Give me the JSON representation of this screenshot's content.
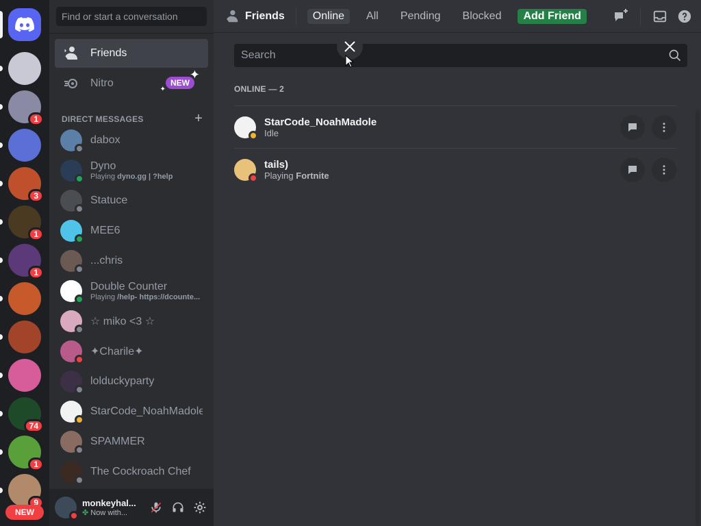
{
  "sidebar": {
    "search_placeholder": "Find or start a conversation",
    "nav": {
      "friends": "Friends",
      "nitro": "Nitro",
      "new_badge": "NEW"
    },
    "dm_header": "DIRECT MESSAGES",
    "dms": [
      {
        "name": "dabox",
        "sub": "",
        "status": "offline",
        "color": "#5b7fa6"
      },
      {
        "name": "Dyno",
        "sub_prefix": "Playing ",
        "sub_bold": "dyno.gg | ?help",
        "status": "online",
        "color": "#2a3c56"
      },
      {
        "name": "Statuce",
        "sub": "",
        "status": "offline",
        "color": "#4a4d52"
      },
      {
        "name": "MEE6",
        "sub": "",
        "status": "online",
        "color": "#4fc3e8"
      },
      {
        "name": "...chris",
        "sub": "",
        "status": "offline",
        "color": "#6b5a54"
      },
      {
        "name": "Double Counter",
        "sub_prefix": "Playing ",
        "sub_bold": "/help- https://dcounte...",
        "status": "online",
        "color": "#ffffff"
      },
      {
        "name": "☆ miko <3 ☆",
        "sub": "",
        "status": "offline",
        "color": "#d9a9c0"
      },
      {
        "name": "✦Charile✦",
        "sub": "",
        "status": "dnd",
        "color": "#b85a8a"
      },
      {
        "name": "lolduckyparty",
        "sub": "",
        "status": "offline",
        "color": "#3b3046"
      },
      {
        "name": "StarCode_NoahMadole",
        "sub": "",
        "status": "idle",
        "color": "#f2f2f2"
      },
      {
        "name": "SPAMMER",
        "sub": "",
        "status": "offline",
        "color": "#8a6b62"
      },
      {
        "name": "The Cockroach Chef",
        "sub": "",
        "status": "offline",
        "color": "#3a2a22"
      }
    ]
  },
  "rail": {
    "servers": [
      {
        "badge": "",
        "color": "#c9c9d6",
        "pill": "dot"
      },
      {
        "badge": "1",
        "color": "#8a8aa5",
        "pill": "dot"
      },
      {
        "badge": "",
        "color": "#5b6fd6",
        "pill": "dot"
      },
      {
        "badge": "3",
        "color": "#c0502c",
        "pill": "dot"
      },
      {
        "badge": "1",
        "color": "#4a3a22",
        "pill": "dot"
      },
      {
        "badge": "1",
        "color": "#5c3a7a",
        "pill": "dot"
      },
      {
        "badge": "",
        "color": "#c75a2a",
        "pill": "dot"
      },
      {
        "badge": "",
        "color": "#a2442a",
        "pill": "dot"
      },
      {
        "badge": "",
        "color": "#d65c9a",
        "pill": "dot"
      },
      {
        "badge": "74",
        "color": "#1e4a2a",
        "pill": "dot"
      },
      {
        "badge": "1",
        "color": "#5aa03a",
        "pill": "dot"
      },
      {
        "badge": "9",
        "color": "#b08a6a",
        "pill": "dot"
      }
    ],
    "new_label": "NEW"
  },
  "user": {
    "name": "monkeyhal...",
    "sub": "Now with...",
    "status": "dnd"
  },
  "header": {
    "title": "Friends",
    "tabs": {
      "online": "Online",
      "all": "All",
      "pending": "Pending",
      "blocked": "Blocked",
      "add": "Add Friend"
    }
  },
  "main": {
    "search_placeholder": "Search",
    "section": "ONLINE — 2",
    "friends": [
      {
        "name": "StarCode_NoahMadole",
        "sub_prefix": "Idle",
        "sub_bold": "",
        "status": "idle",
        "color": "#f2f2f2"
      },
      {
        "name": "tails)",
        "sub_prefix": "Playing ",
        "sub_bold": "Fortnite",
        "status": "dnd",
        "color": "#e8c27a"
      }
    ]
  },
  "colors": {
    "brand": "#5865f2",
    "add_friend": "#248046",
    "danger": "#f23f43"
  }
}
